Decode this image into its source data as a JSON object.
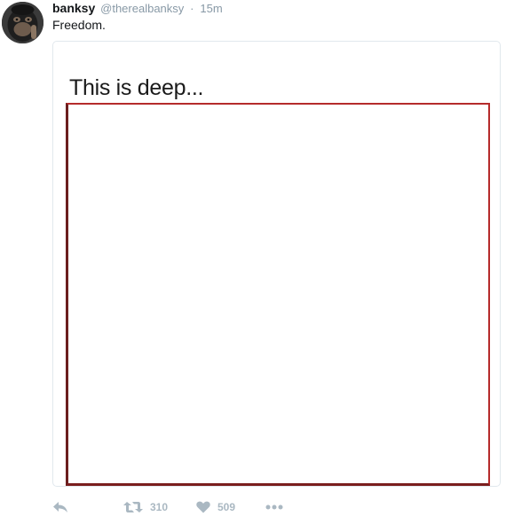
{
  "user": {
    "display_name": "banksy",
    "handle": "@therealbanksy",
    "separator": "·",
    "timestamp": "15m",
    "avatar": "chimpanzee-avatar"
  },
  "tweet": {
    "text": "Freedom."
  },
  "card": {
    "title": "This is deep..."
  },
  "actions": {
    "reply_icon": "reply-icon",
    "retweet_icon": "retweet-icon",
    "retweet_count": "310",
    "like_icon": "heart-icon",
    "like_count": "509",
    "more_icon": "more-icon"
  },
  "colors": {
    "frame_border": "#b52b2b",
    "muted_text": "#8899a6",
    "action_icon": "#aab8c2"
  }
}
